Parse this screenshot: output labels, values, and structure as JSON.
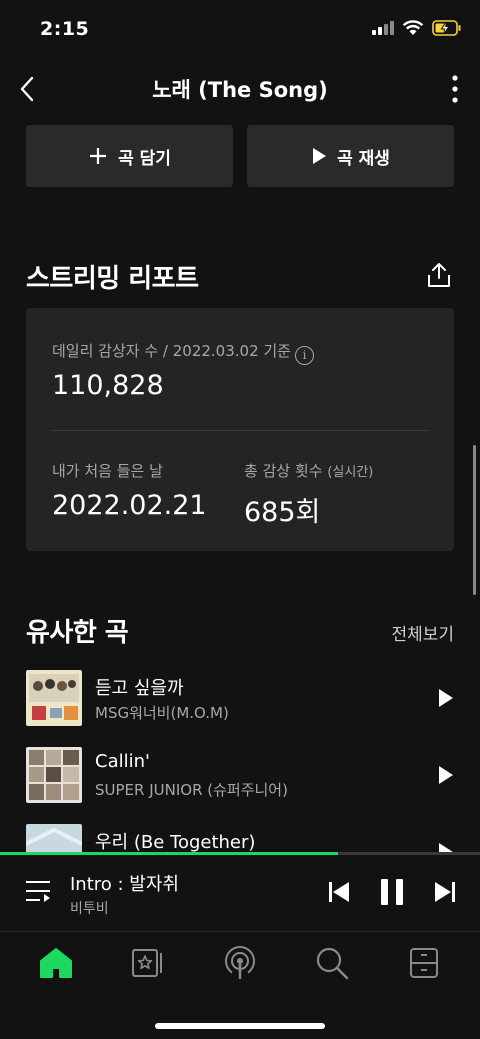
{
  "status_bar": {
    "time": "2:15"
  },
  "nav": {
    "title": "노래 (The Song)"
  },
  "actions": {
    "add_label": "곡 담기",
    "play_label": "곡 재생"
  },
  "report": {
    "title": "스트리밍 리포트",
    "daily_listeners_label": "데일리 감상자 수 / 2022.03.02 기준",
    "daily_listeners_value": "110,828",
    "first_listen_label": "내가 처음 들은 날",
    "first_listen_value": "2022.02.21",
    "total_plays_label": "총 감상 횟수",
    "total_plays_sublabel": "(실시간)",
    "total_plays_value": "685회"
  },
  "similar": {
    "title": "유사한 곡",
    "see_all": "전체보기",
    "songs": [
      {
        "title": "듣고 싶을까",
        "artist": "MSG워너비(M.O.M)"
      },
      {
        "title": "Callin'",
        "artist": "SUPER JUNIOR (슈퍼주니어)"
      },
      {
        "title": "우리 (Be Together)",
        "artist": ""
      }
    ]
  },
  "mini_player": {
    "title": "Intro : 발자취",
    "artist": "비투비",
    "progress": 0.705
  },
  "tabs": [
    {
      "icon": "home-icon",
      "active": true
    },
    {
      "icon": "library-icon",
      "active": false
    },
    {
      "icon": "podcast-icon",
      "active": false
    },
    {
      "icon": "search-icon",
      "active": false
    },
    {
      "icon": "storage-icon",
      "active": false
    }
  ],
  "colors": {
    "accent": "#1ed760",
    "background": "#121212",
    "card": "#242424",
    "button": "#2a2a2a"
  }
}
